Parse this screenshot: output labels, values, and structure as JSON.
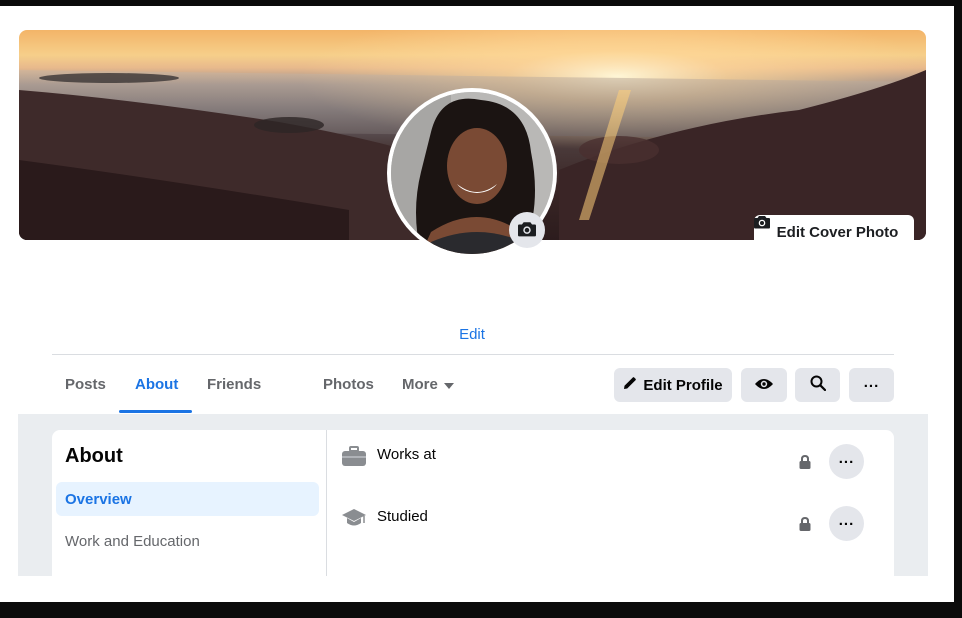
{
  "cover": {
    "edit_cover_label": "Edit Cover Photo"
  },
  "profile": {
    "edit_link": "Edit"
  },
  "tabs": [
    {
      "label": "Posts",
      "active": false
    },
    {
      "label": "About",
      "active": true
    },
    {
      "label": "Friends",
      "active": false
    },
    {
      "label": "Photos",
      "active": false
    },
    {
      "label": "More",
      "active": false
    }
  ],
  "actions": {
    "edit_profile_label": "Edit Profile",
    "more_label": "..."
  },
  "about": {
    "title": "About",
    "sidebar": [
      {
        "label": "Overview",
        "active": true
      },
      {
        "label": "Work and Education",
        "active": false
      }
    ],
    "rows": [
      {
        "label": "Works at",
        "icon": "briefcase-icon"
      },
      {
        "label": "Studied",
        "icon": "graduation-cap-icon"
      }
    ]
  },
  "colors": {
    "accent": "#1b74e4",
    "button_bg": "#e4e6eb",
    "active_bg": "#e7f3ff"
  }
}
